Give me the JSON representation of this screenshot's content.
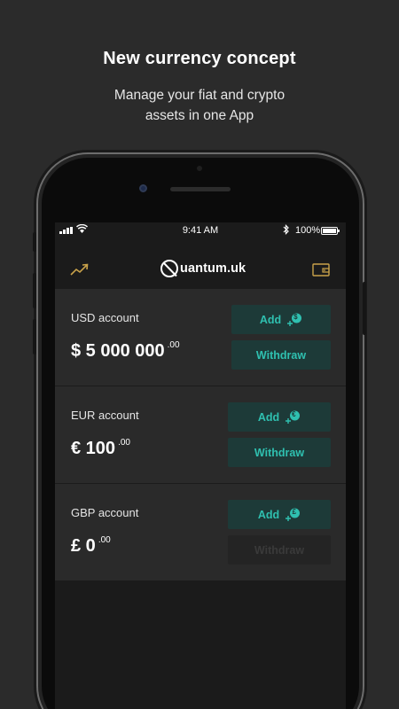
{
  "promo": {
    "title": "New currency concept",
    "subtitle_line1": "Manage your fiat and crypto",
    "subtitle_line2": "assets in one App"
  },
  "status_bar": {
    "time": "9:41 AM",
    "battery": "100%"
  },
  "app": {
    "logo_text": "uantum.uk"
  },
  "accounts": [
    {
      "label": "USD account",
      "symbol": "$",
      "amount": "$ 5 000 000",
      "cents": ".00",
      "add_label": "Add",
      "withdraw_label": "Withdraw",
      "withdraw_enabled": true
    },
    {
      "label": "EUR account",
      "symbol": "€",
      "amount": "€ 100",
      "cents": ".00",
      "add_label": "Add",
      "withdraw_label": "Withdraw",
      "withdraw_enabled": true
    },
    {
      "label": "GBP account",
      "symbol": "£",
      "amount": "£ 0",
      "cents": ".00",
      "add_label": "Add",
      "withdraw_label": "Withdraw",
      "withdraw_enabled": false
    }
  ],
  "icons": {
    "trend": "trend-up-icon",
    "wallet": "wallet-icon",
    "logo": "no-symbol-q-icon",
    "add_coin": "add-coin-icon"
  },
  "colors": {
    "background": "#2b2b2b",
    "screen": "#1b1b1b",
    "card": "#2a2a2a",
    "accent": "#2fc0b0",
    "button_bg": "#1d3a38",
    "gold": "#c9a24a"
  }
}
